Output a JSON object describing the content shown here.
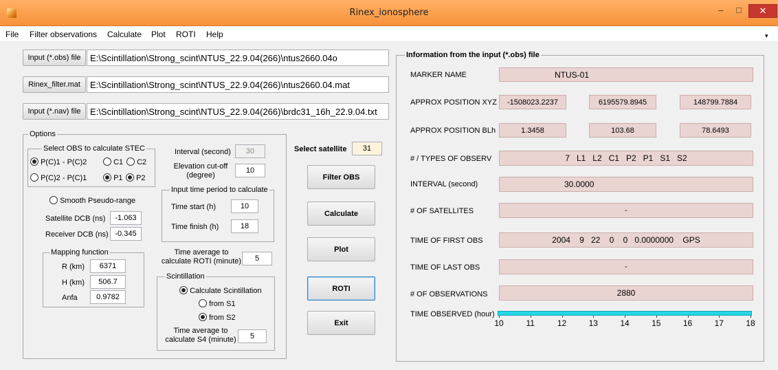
{
  "window": {
    "title": "Rinex_ionosphere",
    "min": "–",
    "max": "□",
    "close": "✕",
    "icon": "matlab-icon"
  },
  "menu": {
    "items": [
      "File",
      "Filter observations",
      "Calculate",
      "Plot",
      "ROTI",
      "Help"
    ],
    "arrow": "▾"
  },
  "files": {
    "obs_button": "Input (*.obs) file",
    "obs_path": "E:\\Scintillation\\Strong_scint\\NTUS_22.9.04(266)\\ntus2660.04o",
    "filter_button": "Rinex_filter.mat",
    "filter_path": "E:\\Scintillation\\Strong_scint\\NTUS_22.9.04(266)\\ntus2660.04.mat",
    "nav_button": "Input (*.nav) file",
    "nav_path": "E:\\Scintillation\\Strong_scint\\NTUS_22.9.04(266)\\brdc31_16h_22.9.04.txt"
  },
  "options": {
    "title": "Options",
    "stec_group": "Select OBS to calculate STEC",
    "r1": "P(C)1 - P(C)2",
    "r2": "C1",
    "r3": "C2",
    "r4": "P(C)2 - P(C)1",
    "r5": "P1",
    "r6": "P2",
    "smooth": "Smooth Pseudo-range",
    "sat_dcb_label": "Satellite DCB (ns)",
    "sat_dcb": "-1.063",
    "rec_dcb_label": "Receiver DCB (ns)",
    "rec_dcb": "-0.345",
    "mapping_title": "Mapping function",
    "r_label": "R (km)",
    "r_value": "6371",
    "h_label": "H (km)",
    "h_value": "506.7",
    "anfa_label": "Anfa",
    "anfa_value": "0.9782",
    "interval_label": "Interval (second)",
    "interval_value": "30",
    "elev_label": "Elevation cut-off (degree)",
    "elev_value": "10",
    "period_title": "Input time period to calculate",
    "start_label": "Time start (h)",
    "start_value": "10",
    "finish_label": "Time finish (h)",
    "finish_value": "18",
    "roti_avg_label": "Time average to calculate ROTI (minute)",
    "roti_avg_value": "5",
    "scint_title": "Scintillation",
    "calc_scint": "Calculate Scintillation",
    "from_s1": "from S1",
    "from_s2": "from S2",
    "s4_avg_label": "Time average to calculate S4 (minute)",
    "s4_avg_value": "5"
  },
  "actions": {
    "select_sat_label": "Select satellite",
    "select_sat_value": "31",
    "filter": "Filter OBS",
    "calculate": "Calculate",
    "plot": "Plot",
    "roti": "ROTI",
    "exit": "Exit"
  },
  "info": {
    "title": "Information from the input (*.obs) file",
    "marker_label": "MARKER NAME",
    "marker": "NTUS-01",
    "xyz_label": "APPROX POSITION XYZ",
    "x": "-1508023.2237",
    "y": "6195579.8945",
    "z": "148799.7884",
    "blh_label": "APPROX POSITION BLh",
    "b": "1.3458",
    "l": "103.68",
    "h": "78.6493",
    "types_label": "# / TYPES OF OBSERV",
    "types": "7   L1   L2   C1   P2   P1   S1   S2",
    "interval_label": "INTERVAL (second)",
    "interval": "30.0000",
    "sats_label": "# OF SATELLITES",
    "sats": "-",
    "first_label": "TIME OF FIRST OBS",
    "first": "2004    9   22    0    0   0.0000000    GPS",
    "last_label": "TIME OF LAST OBS",
    "last": "-",
    "nobs_label": "# OF OBSERVATIONS",
    "nobs": "2880",
    "observed_label": "TIME OBSERVED (hour)",
    "ticks": [
      "10",
      "11",
      "12",
      "13",
      "14",
      "15",
      "16",
      "17",
      "18"
    ],
    "observed_range": [
      10,
      18
    ]
  }
}
